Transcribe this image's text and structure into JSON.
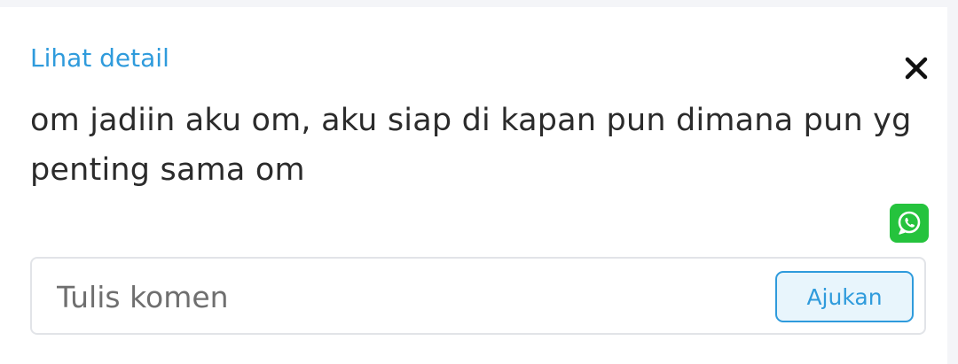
{
  "card": {
    "detail_link": "Lihat detail",
    "message": "om jadiin aku om, aku siap di kapan pun dimana pun yg penting sama om",
    "close_icon": "close-icon",
    "share_icon": "whatsapp-icon"
  },
  "comment": {
    "placeholder": "Tulis komen",
    "value": "",
    "submit_label": "Ajukan"
  },
  "colors": {
    "accent": "#2f9bdc",
    "whatsapp": "#25c33d",
    "text": "#2b2b2b"
  }
}
